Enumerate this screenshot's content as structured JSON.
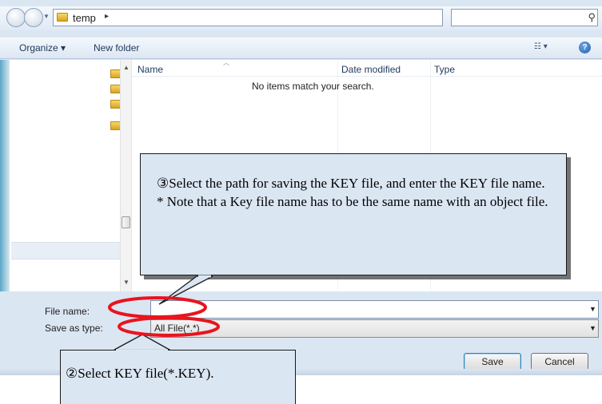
{
  "address_bar": {
    "path_segment": "temp",
    "path_arrow": "▸",
    "search_placeholder": ""
  },
  "toolbar": {
    "organize_label": "Organize ▾",
    "new_folder_label": "New folder"
  },
  "file_list": {
    "columns": [
      "Name",
      "Date modified",
      "Type"
    ],
    "empty_message": "No items match your search."
  },
  "fields": {
    "file_name_label": "File name:",
    "file_name_value": "",
    "save_as_type_label": "Save as type:",
    "save_as_type_value": "All File(*.*)"
  },
  "buttons": {
    "save_label": "Save",
    "cancel_label": "Cancel"
  },
  "annotations": {
    "callout3_line1": "③Select the path for saving the KEY file, and enter the KEY file name.",
    "callout3_line2": "* Note that a Key file name has to be the same name with an object file.",
    "callout2_text": "②Select KEY file(*.KEY)."
  },
  "colors": {
    "dialog_bg": "#dbe6f3",
    "highlight_ellipse": "#e8141e"
  },
  "icons": [
    "back-icon",
    "forward-icon",
    "folder-icon",
    "refresh-icon",
    "search-icon",
    "views-icon",
    "help-icon"
  ]
}
